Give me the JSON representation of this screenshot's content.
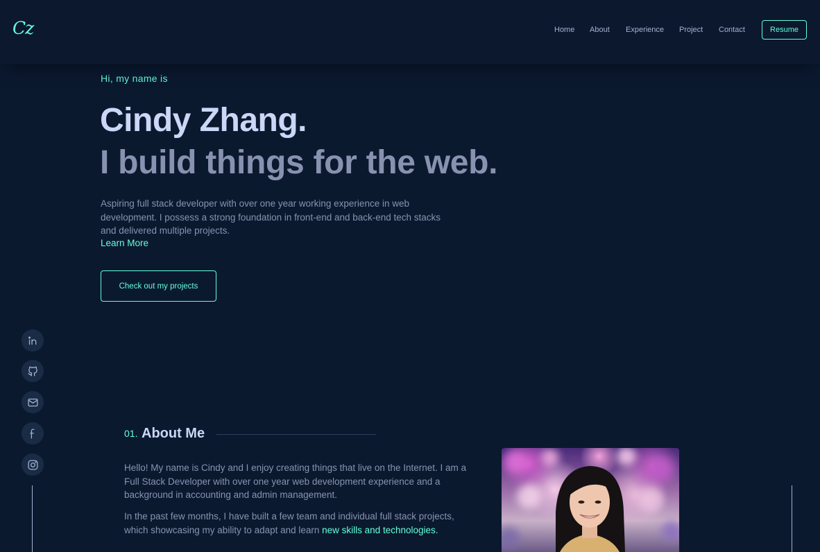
{
  "logo": "Cz",
  "nav": {
    "items": [
      "Home",
      "About",
      "Experience",
      "Project",
      "Contact"
    ],
    "resume": "Resume"
  },
  "hero": {
    "greeting": "Hi, my name is",
    "name": "Cindy Zhang.",
    "tagline": "I build things for the web.",
    "bio": "Aspiring full stack developer with over one year working experience in web development. I possess a strong foundation in front-end and back-end tech stacks and delivered multiple projects.",
    "learn_more": "Learn More",
    "cta": "Check out my projects"
  },
  "social": {
    "icons": [
      "linkedin-icon",
      "github-icon",
      "mail-icon",
      "facebook-icon",
      "instagram-icon"
    ]
  },
  "about": {
    "number": "01.",
    "title": "About Me",
    "p1": "Hello! My name is Cindy and I enjoy creating things that live on the Internet. I am a Full Stack Developer with over one year web development experience and a background in accounting and admin management.",
    "p2_start": "In the past few months, I have built a few team and individual full stack projects, which showcasing my ability to adapt and learn ",
    "p2_highlight": "new skills and technologies."
  },
  "colors": {
    "background": "#0b192f",
    "accent": "#64ffda",
    "heading": "#ccd6f6",
    "text": "#8892b0"
  }
}
